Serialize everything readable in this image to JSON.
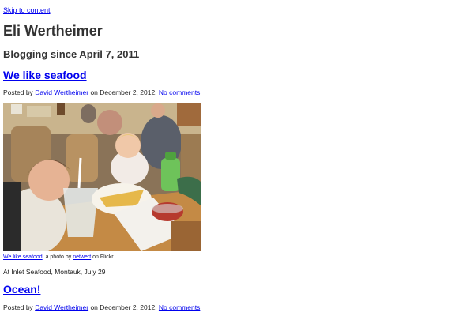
{
  "skip_link": "Skip to content",
  "site": {
    "title": "Eli Wertheimer",
    "description": "Blogging since April 7, 2011"
  },
  "posts": [
    {
      "title": "We like seafood",
      "meta": {
        "posted_by": "Posted by",
        "author": "David Wertheimer",
        "on": "on December 2, 2012.",
        "comments": "No comments",
        "end": "."
      },
      "photo": {
        "caption_link": "We like seafood",
        "caption_mid": ", a photo by",
        "caption_user": "netwert",
        "caption_end": "on Flickr."
      },
      "body": "At Inlet Seafood, Montauk, July 29"
    },
    {
      "title": "Ocean!",
      "meta": {
        "posted_by": "Posted by",
        "author": "David Wertheimer",
        "on": "on December 2, 2012.",
        "comments": "No comments",
        "end": "."
      }
    }
  ],
  "colors": {
    "link": "#0000ee",
    "text": "#333333",
    "background": "#ffffff"
  }
}
